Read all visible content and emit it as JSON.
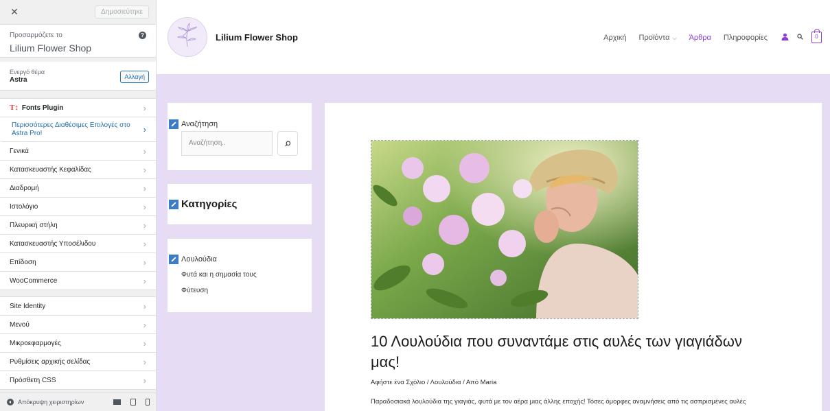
{
  "customizer": {
    "close_label": "✕",
    "publish_label": "Δημοσιεύτηκε",
    "info_small": "Προσαρμόζετε το",
    "info_title": "Lilium Flower Shop",
    "help_label": "?",
    "theme_small": "Ενεργό θέμα",
    "theme_name": "Astra",
    "change_label": "Αλλαγή",
    "fonts_plugin": "Fonts Plugin",
    "pro_item": "Περισσότερες Διαθέσιμες Επιλογές στο Astra Pro!",
    "items_a": [
      "Γενικά",
      "Κατασκευαστής Κεφαλίδας",
      "Διαδρομή",
      "Ιστολόγιο",
      "Πλευρική στήλη",
      "Κατασκευαστής Υποσέλιδου",
      "Επίδοση",
      "WooCommerce"
    ],
    "items_b": [
      "Site Identity",
      "Μενού",
      "Μικροεφαρμογές",
      "Ρυθμίσεις αρχικής σελίδας",
      "Πρόσθετη CSS"
    ],
    "hide_controls": "Απόκρυψη χειριστηρίων"
  },
  "site": {
    "title": "Lilium Flower Shop",
    "nav": {
      "home": "Αρχική",
      "products": "Προϊόντα",
      "articles": "Άρθρα",
      "info": "Πληροφορίες",
      "cart_count": "0"
    },
    "accent": "#8b3fd6",
    "search_widget": {
      "title": "Αναζήτηση",
      "placeholder": "Αναζήτηση.."
    },
    "categories_title": "Κατηγορίες",
    "category_list": {
      "title": "Λουλούδια",
      "items": [
        "Φυτά και η σημασία τους",
        "Φύτευση"
      ]
    },
    "article": {
      "title": "10 Λουλούδια που συναντάμε στις αυλές των γιαγιάδων μας!",
      "meta": "Αφήστε ένα Σχόλιο / Λουλούδια / Από Maria",
      "excerpt": "Παραδοσιακά λουλούδια της γιαγιάς, φυτά με τον αέρα μιας άλλης εποχής! Τόσες όμορφες αναμνήσεις από τις ασπρισμένες αυλές"
    }
  }
}
